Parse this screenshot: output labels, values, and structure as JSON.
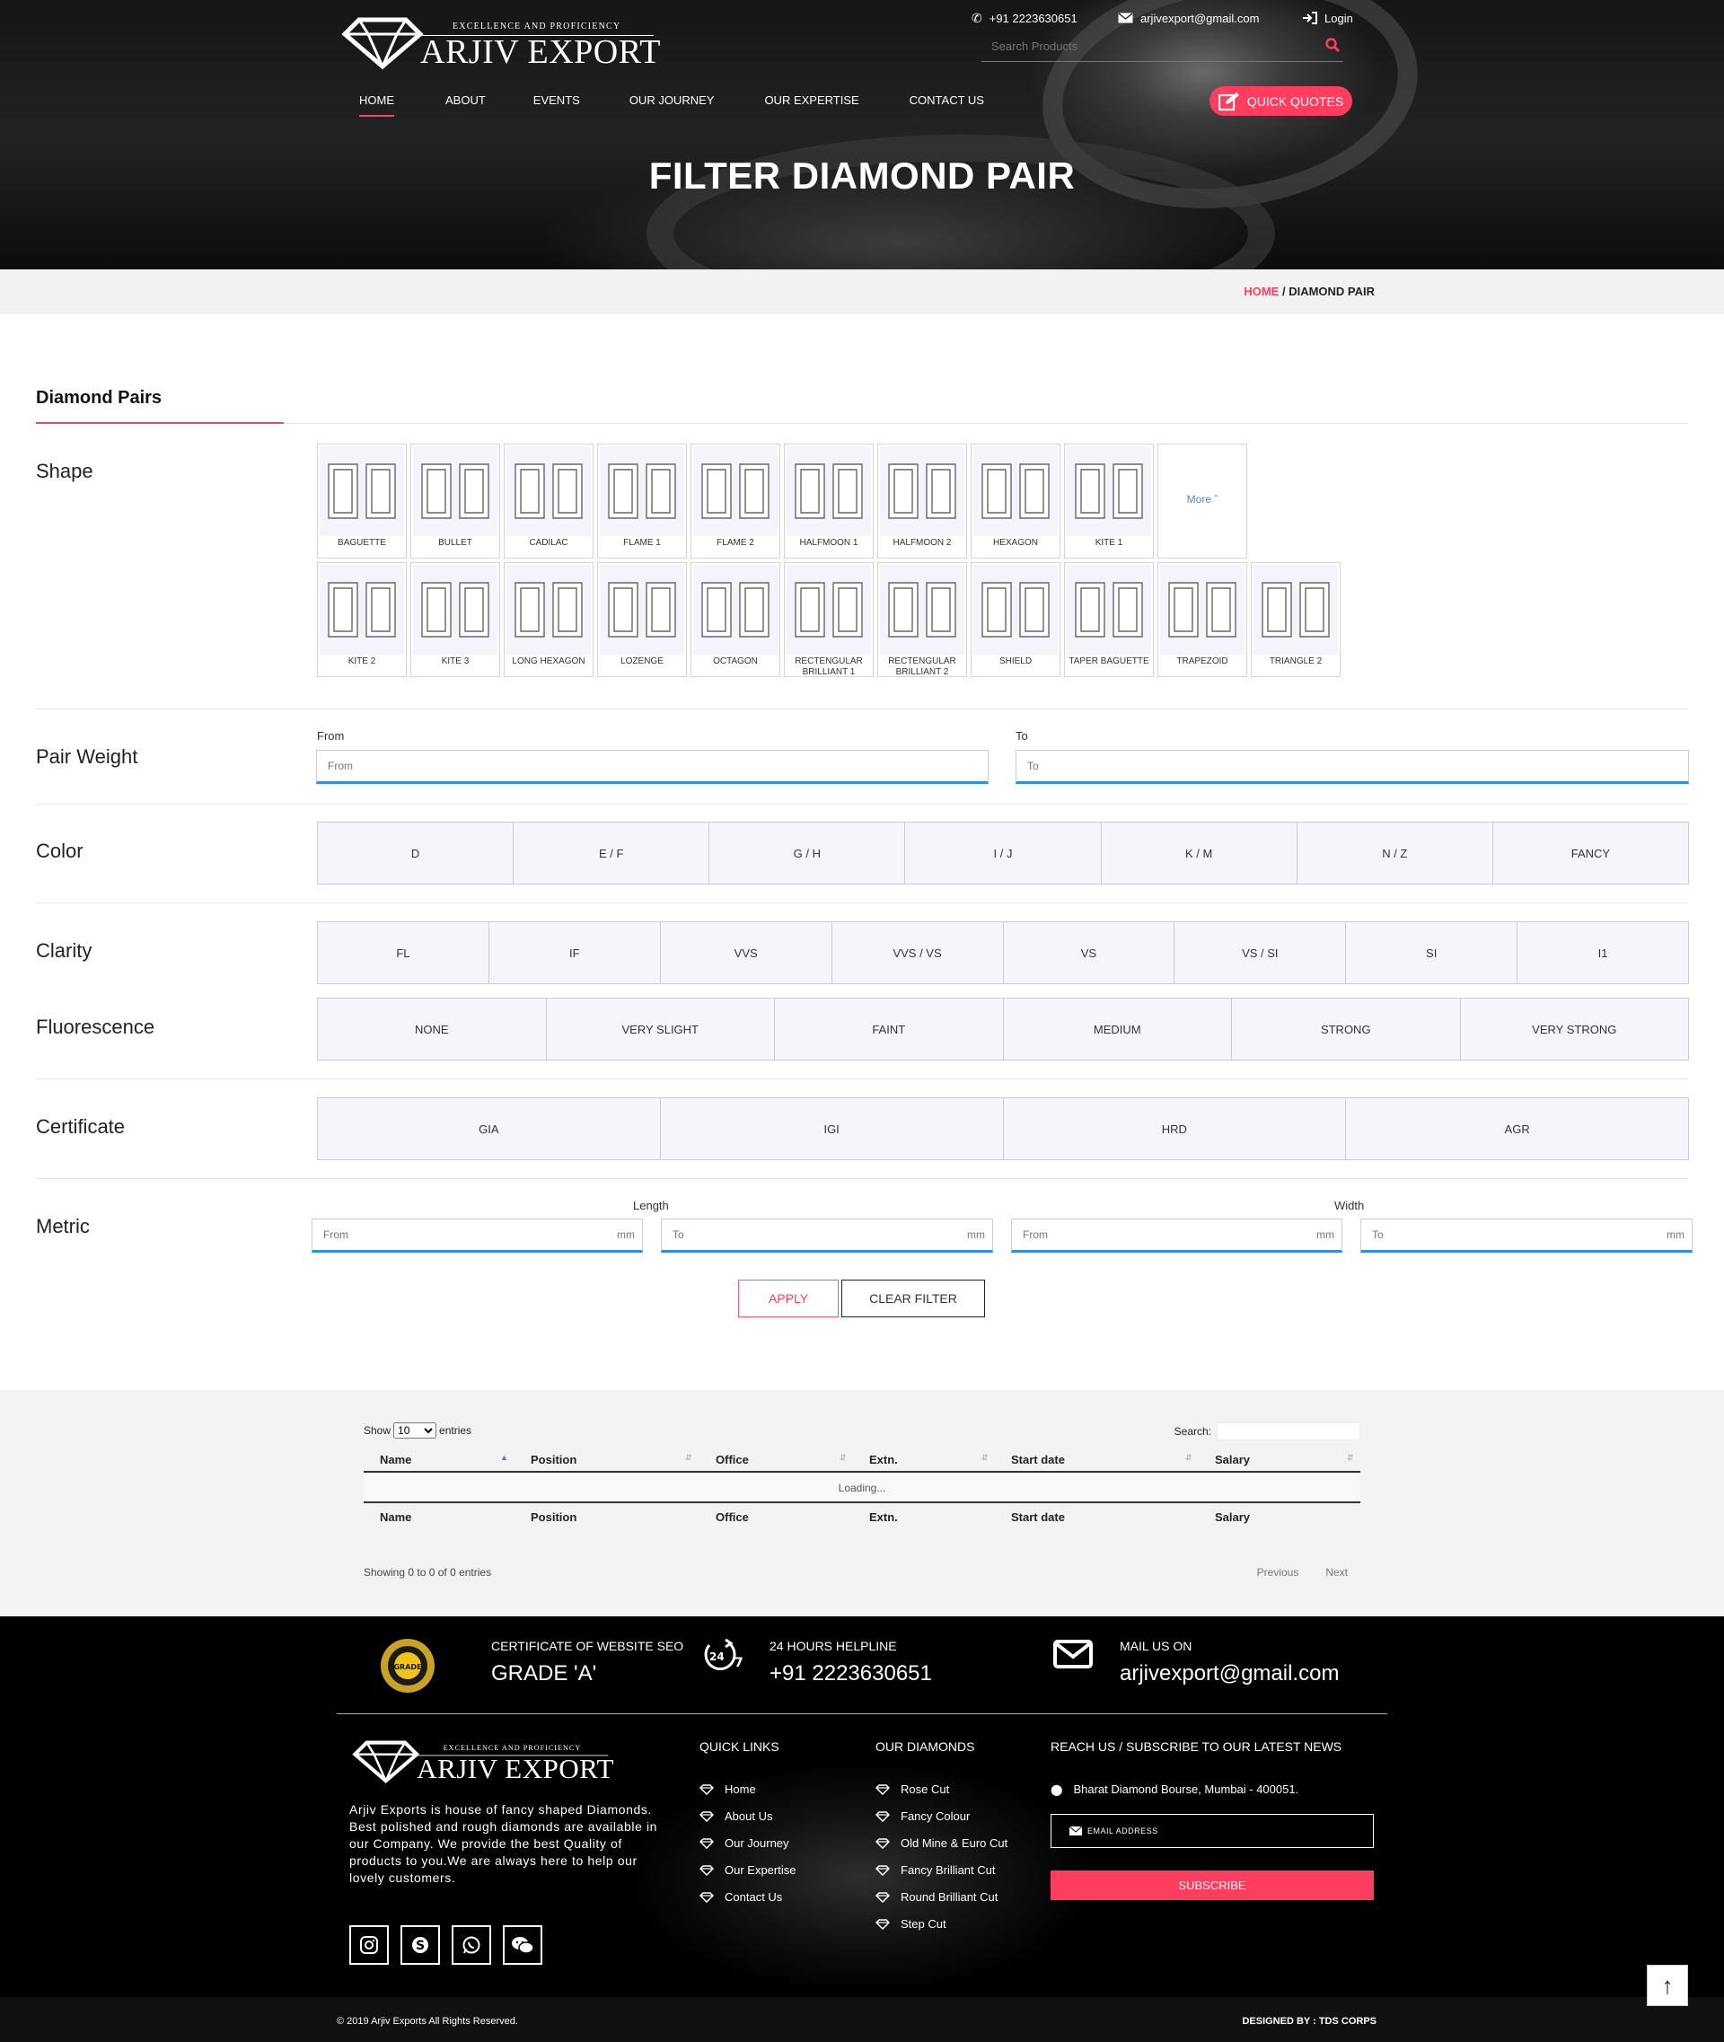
{
  "header": {
    "logo_tagline": "EXCELLENCE AND PROFICIENCY",
    "logo_name": "ARJIV EXPORT",
    "phone": "+91 2223630651",
    "email": "arjivexport@gmail.com",
    "login": "Login",
    "search_placeholder": "Search Products",
    "nav": [
      "HOME",
      "ABOUT",
      "EVENTS",
      "OUR JOURNEY",
      "OUR EXPERTISE",
      "CONTACT US"
    ],
    "quick_quotes": "QUICK QUOTES",
    "page_title": "FILTER DIAMOND PAIR"
  },
  "breadcrumb": {
    "home": "HOME",
    "sep": "/",
    "current": "DIAMOND PAIR"
  },
  "filter": {
    "section_title": "Diamond Pairs",
    "shape_label": "Shape",
    "shapes_row1": [
      "BAGUETTE",
      "BULLET",
      "CADILAC",
      "FLAME 1",
      "FLAME 2",
      "HALFMOON 1",
      "HALFMOON 2",
      "HEXAGON",
      "KITE 1"
    ],
    "more_label": "More",
    "shapes_row2": [
      "KITE 2",
      "KITE 3",
      "LONG HEXAGON",
      "LOZENGE",
      "OCTAGON",
      "RECTENGULAR BRILLIANT 1",
      "RECTENGULAR BRILLIANT 2",
      "SHIELD",
      "TAPER BAGUETTE",
      "TRAPEZOID",
      "TRIANGLE 2"
    ],
    "pair_weight_label": "Pair Weight",
    "from_label": "From",
    "to_label": "To",
    "from_placeholder": "From",
    "to_placeholder": "To",
    "color_label": "Color",
    "colors": [
      "D",
      "E / F",
      "G / H",
      "I / J",
      "K / M",
      "N / Z",
      "FANCY"
    ],
    "clarity_label": "Clarity",
    "clarities": [
      "FL",
      "IF",
      "VVS",
      "VVS / VS",
      "VS",
      "VS / SI",
      "SI",
      "I1"
    ],
    "fluorescence_label": "Fluorescence",
    "fluorescences": [
      "NONE",
      "VERY SLIGHT",
      "FAINT",
      "MEDIUM",
      "STRONG",
      "VERY STRONG"
    ],
    "certificate_label": "Certificate",
    "certificates": [
      "GIA",
      "IGI",
      "HRD",
      "AGR"
    ],
    "metric_label": "Metric",
    "length_label": "Length",
    "width_label": "Width",
    "unit": "mm",
    "apply": "APPLY",
    "clear": "CLEAR FILTER"
  },
  "table": {
    "show": "Show",
    "entries_value": "10",
    "entries": "entries",
    "search": "Search:",
    "columns": [
      "Name",
      "Position",
      "Office",
      "Extn.",
      "Start date",
      "Salary"
    ],
    "loading": "Loading...",
    "info": "Showing 0 to 0 of 0 entries",
    "previous": "Previous",
    "next": "Next"
  },
  "footer": {
    "cert_title": "CERTIFICATE OF WEBSITE SEO",
    "cert_value": "GRADE 'A'",
    "helpline_title": "24 HOURS HELPLINE",
    "helpline_value": "+91 2223630651",
    "mail_title": "MAIL US ON",
    "mail_value": "arjivexport@gmail.com",
    "description": "Arjiv Exports is house of fancy shaped Diamonds. Best polished and rough diamonds are available in our Company. We provide the best Quality of products to you.We are always here to help our lovely customers.",
    "quick_links_title": "QUICK LINKS",
    "quick_links": [
      "Home",
      "About Us",
      "Our Journey",
      "Our Expertise",
      "Contact Us"
    ],
    "our_diamonds_title": "OUR DIAMONDS",
    "our_diamonds": [
      "Rose Cut",
      "Fancy Colour",
      "Old Mine & Euro Cut",
      "Fancy Brilliant Cut",
      "Round Brilliant Cut",
      "Step Cut"
    ],
    "reach_title": "REACH US / SUBSCRIBE TO OUR LATEST NEWS",
    "address": "Bharat Diamond Bourse, Mumbai - 400051.",
    "email_placeholder": "EMAIL ADDRESS",
    "subscribe": "SUBSCRIBE",
    "copyright": "© 2019 Arjiv Exports All Rights Reserved.",
    "designed_by": "DESIGNED BY : TDS CORPS"
  },
  "colors": {
    "accent": "#ff3d5f",
    "input_underline": "#2e8fe6",
    "option_bg": "#f5f6fb"
  }
}
